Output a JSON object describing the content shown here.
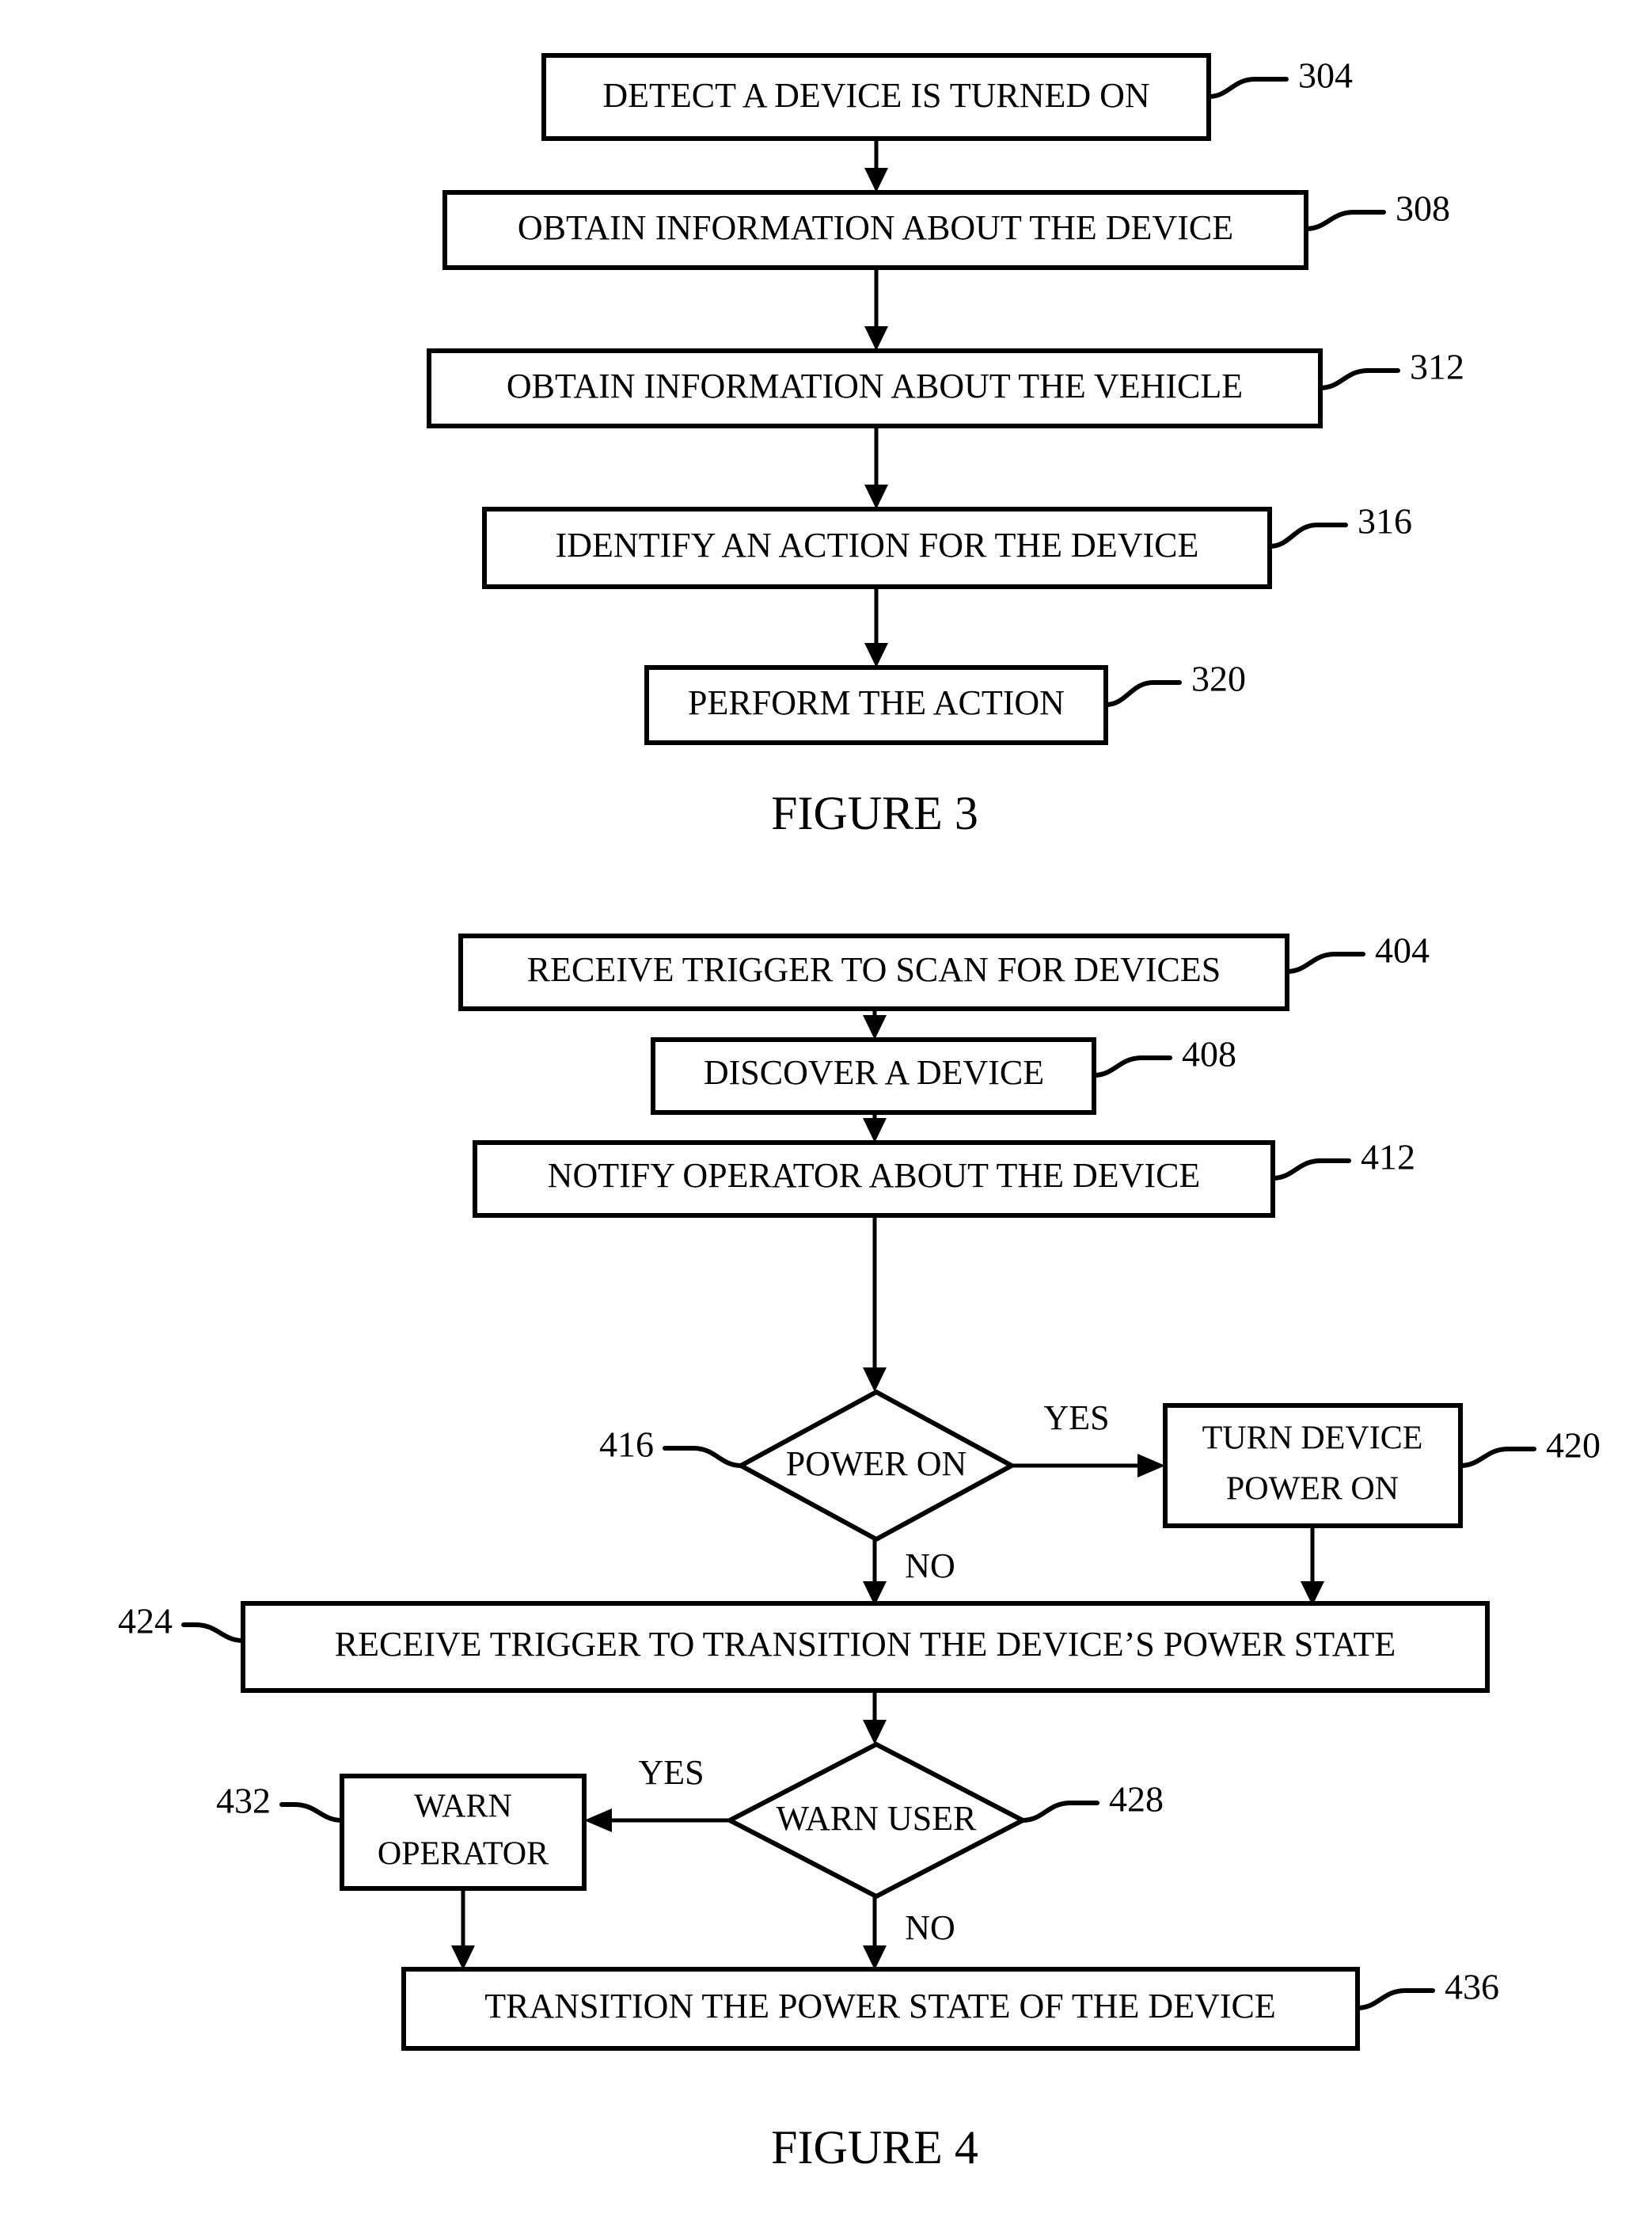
{
  "document": {
    "type": "patent-flowchart-sheet",
    "ink_color": "#000000",
    "background_color": "#ffffff"
  },
  "figures": [
    {
      "id": "figure-3",
      "caption": "FIGURE 3",
      "nodes": [
        {
          "ref": "304",
          "shape": "process",
          "text": "DETECT A DEVICE IS TURNED ON"
        },
        {
          "ref": "308",
          "shape": "process",
          "text": "OBTAIN INFORMATION ABOUT THE DEVICE"
        },
        {
          "ref": "312",
          "shape": "process",
          "text": "OBTAIN INFORMATION ABOUT THE VEHICLE"
        },
        {
          "ref": "316",
          "shape": "process",
          "text": "IDENTIFY AN ACTION FOR THE DEVICE"
        },
        {
          "ref": "320",
          "shape": "process",
          "text": "PERFORM THE ACTION"
        }
      ],
      "edges": [
        {
          "from": "304",
          "to": "308",
          "label": ""
        },
        {
          "from": "308",
          "to": "312",
          "label": ""
        },
        {
          "from": "312",
          "to": "316",
          "label": ""
        },
        {
          "from": "316",
          "to": "320",
          "label": ""
        }
      ]
    },
    {
      "id": "figure-4",
      "caption": "FIGURE 4",
      "nodes": [
        {
          "ref": "404",
          "shape": "process",
          "text": "RECEIVE TRIGGER TO SCAN FOR DEVICES"
        },
        {
          "ref": "408",
          "shape": "process",
          "text": "DISCOVER A DEVICE"
        },
        {
          "ref": "412",
          "shape": "process",
          "text": "NOTIFY OPERATOR ABOUT THE DEVICE"
        },
        {
          "ref": "416",
          "shape": "decision",
          "text": "POWER ON"
        },
        {
          "ref": "420",
          "shape": "process",
          "text_line1": "TURN DEVICE",
          "text_line2": "POWER ON"
        },
        {
          "ref": "424",
          "shape": "process",
          "text": "RECEIVE TRIGGER TO TRANSITION THE DEVICE’S POWER STATE"
        },
        {
          "ref": "428",
          "shape": "decision",
          "text": "WARN USER"
        },
        {
          "ref": "432",
          "shape": "process",
          "text_line1": "WARN",
          "text_line2": "OPERATOR"
        },
        {
          "ref": "436",
          "shape": "process",
          "text": "TRANSITION THE POWER STATE OF THE DEVICE"
        }
      ],
      "edges": [
        {
          "from": "404",
          "to": "408",
          "label": ""
        },
        {
          "from": "408",
          "to": "412",
          "label": ""
        },
        {
          "from": "412",
          "to": "416",
          "label": ""
        },
        {
          "from": "416",
          "to": "420",
          "label": "YES"
        },
        {
          "from": "416",
          "to": "424",
          "label": "NO"
        },
        {
          "from": "420",
          "to": "424",
          "label": ""
        },
        {
          "from": "424",
          "to": "428",
          "label": ""
        },
        {
          "from": "428",
          "to": "432",
          "label": "YES"
        },
        {
          "from": "428",
          "to": "436",
          "label": "NO"
        },
        {
          "from": "432",
          "to": "436",
          "label": ""
        }
      ]
    }
  ],
  "fig3": {
    "n304": "DETECT A DEVICE IS TURNED ON",
    "n308": "OBTAIN INFORMATION ABOUT THE DEVICE",
    "n312": "OBTAIN INFORMATION ABOUT THE VEHICLE",
    "n316": "IDENTIFY AN ACTION FOR THE DEVICE",
    "n320": "PERFORM THE ACTION",
    "r304": "304",
    "r308": "308",
    "r312": "312",
    "r316": "316",
    "r320": "320",
    "caption": "FIGURE 3"
  },
  "fig4": {
    "n404": "RECEIVE TRIGGER TO SCAN FOR DEVICES",
    "n408": "DISCOVER A DEVICE",
    "n412": "NOTIFY OPERATOR ABOUT THE DEVICE",
    "n416": "POWER ON",
    "n420a": "TURN DEVICE",
    "n420b": "POWER ON",
    "n424": "RECEIVE TRIGGER TO TRANSITION THE DEVICE’S POWER STATE",
    "n428": "WARN USER",
    "n432a": "WARN",
    "n432b": "OPERATOR",
    "n436": "TRANSITION THE POWER STATE OF THE DEVICE",
    "r404": "404",
    "r408": "408",
    "r412": "412",
    "r416": "416",
    "r420": "420",
    "r424": "424",
    "r428": "428",
    "r432": "432",
    "r436": "436",
    "yes1": "YES",
    "no1": "NO",
    "yes2": "YES",
    "no2": "NO",
    "caption": "FIGURE 4"
  }
}
